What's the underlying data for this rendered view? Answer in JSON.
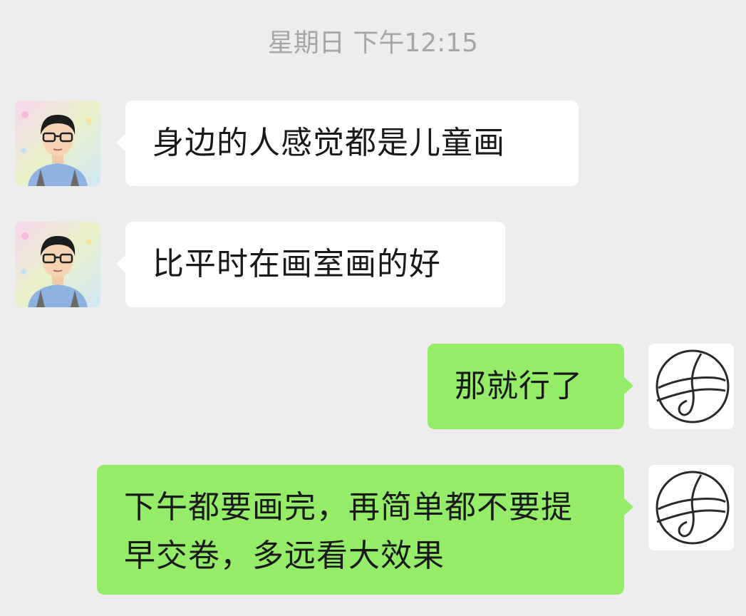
{
  "chat": {
    "timestamp": "星期日 下午12:15",
    "messages": [
      {
        "sender": "other",
        "avatar": "boy-avatar-icon",
        "text": "身边的人感觉都是儿童画"
      },
      {
        "sender": "other",
        "avatar": "boy-avatar-icon",
        "text": "比平时在画室画的好"
      },
      {
        "sender": "self",
        "avatar": "signature-circle-icon",
        "text": "那就行了"
      },
      {
        "sender": "self",
        "avatar": "signature-circle-icon",
        "text": "下午都要画完，再简单都不要提早交卷，多远看大效果"
      }
    ]
  },
  "colors": {
    "background": "#ededed",
    "incoming_bubble": "#ffffff",
    "outgoing_bubble": "#95ec69",
    "timestamp_text": "#a6a6a6",
    "message_text": "#191919"
  }
}
